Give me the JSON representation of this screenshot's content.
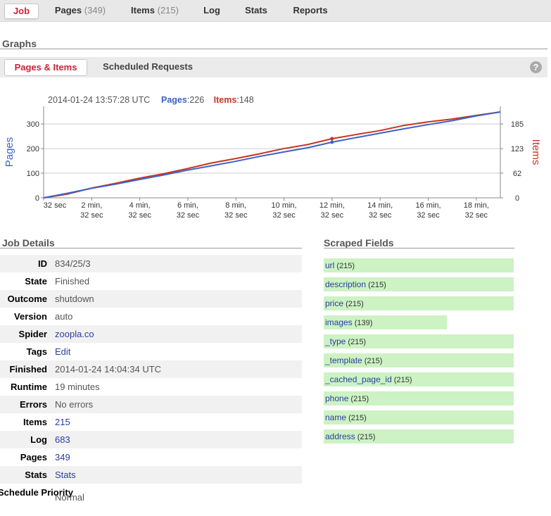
{
  "tabs": [
    {
      "label": "Job",
      "count": "",
      "active": true
    },
    {
      "label": "Pages",
      "count": "(349)"
    },
    {
      "label": "Items",
      "count": "(215)"
    },
    {
      "label": "Log",
      "count": ""
    },
    {
      "label": "Stats",
      "count": ""
    },
    {
      "label": "Reports",
      "count": ""
    }
  ],
  "graphs": {
    "title": "Graphs",
    "subtabs": [
      "Pages & Items",
      "Scheduled Requests"
    ],
    "help_icon": "?"
  },
  "chart_data": {
    "type": "line",
    "timestamp": "2014-01-24 13:57:28 UTC",
    "readout": [
      {
        "name": "Pages",
        "value": "226",
        "color": "#3c62c8"
      },
      {
        "name": "Items",
        "value": "148",
        "color": "#c8341e"
      }
    ],
    "left_axis_label": "Pages",
    "right_axis_label": "Items",
    "left_ticks": [
      0,
      100,
      200,
      300
    ],
    "right_ticks": [
      0,
      62,
      123,
      185
    ],
    "left_ylim": [
      0,
      349
    ],
    "right_ylim": [
      0,
      215
    ],
    "x_ticks": [
      "32 sec",
      "2 min, 32 sec",
      "4 min, 32 sec",
      "6 min, 32 sec",
      "8 min, 32 sec",
      "10 min, 32 sec",
      "12 min, 32 sec",
      "14 min, 32 sec",
      "16 min, 32 sec",
      "18 min, 32 sec"
    ],
    "x_minutes": [
      0.533,
      2.533,
      4.533,
      6.533,
      8.533,
      10.533,
      12.533,
      14.533,
      16.533,
      18.533
    ],
    "xlim": [
      0.533,
      19.533
    ],
    "series": [
      {
        "name": "Pages",
        "axis": "left",
        "color": "#3c62c8",
        "x": [
          0.533,
          1.5,
          2.5,
          3.5,
          4.5,
          5.5,
          6.5,
          7.5,
          8.5,
          9.5,
          10.5,
          11.5,
          12.53,
          13.5,
          14.5,
          15.5,
          16.5,
          17.5,
          18.5,
          19.533
        ],
        "y": [
          0,
          18,
          38,
          55,
          74,
          92,
          112,
          130,
          148,
          168,
          186,
          203,
          226,
          244,
          262,
          280,
          297,
          313,
          332,
          349
        ]
      },
      {
        "name": "Items",
        "axis": "right",
        "color": "#c8341e",
        "x": [
          0.533,
          1.5,
          2.5,
          3.5,
          4.5,
          5.5,
          6.5,
          7.5,
          8.5,
          9.5,
          10.5,
          11.5,
          12.53,
          13.5,
          14.5,
          15.5,
          16.5,
          17.5,
          18.5,
          19.533
        ],
        "y": [
          0,
          9,
          24,
          36,
          49,
          60,
          73,
          87,
          98,
          110,
          123,
          133,
          148,
          158,
          168,
          181,
          190,
          197,
          206,
          215
        ]
      }
    ],
    "highlight_x": 12.53
  },
  "details": {
    "title": "Job Details",
    "rows": [
      {
        "label": "ID",
        "value": "834/25/3",
        "link": false
      },
      {
        "label": "State",
        "value": "Finished",
        "link": false
      },
      {
        "label": "Outcome",
        "value": "shutdown",
        "link": false
      },
      {
        "label": "Version",
        "value": "auto",
        "link": false
      },
      {
        "label": "Spider",
        "value": "zoopla.co",
        "link": true
      },
      {
        "label": "Tags",
        "value": "Edit",
        "link": true
      },
      {
        "label": "Finished",
        "value": "2014-01-24 14:04:34 UTC",
        "link": false
      },
      {
        "label": "Runtime",
        "value": "19 minutes",
        "link": false
      },
      {
        "label": "Errors",
        "value": "No errors",
        "link": false
      },
      {
        "label": "Items",
        "value": "215",
        "link": true
      },
      {
        "label": "Log",
        "value": "683",
        "link": true
      },
      {
        "label": "Pages",
        "value": "349",
        "link": true
      },
      {
        "label": "Stats",
        "value": "Stats",
        "link": true
      },
      {
        "label": "Schedule Priority",
        "value": "Normal",
        "link": false
      }
    ]
  },
  "scraped_fields": {
    "title": "Scraped Fields",
    "total": 215,
    "items": [
      {
        "name": "url",
        "count": 215
      },
      {
        "name": "description",
        "count": 215
      },
      {
        "name": "price",
        "count": 215
      },
      {
        "name": "images",
        "count": 139
      },
      {
        "name": "_type",
        "count": 215
      },
      {
        "name": "_template",
        "count": 215
      },
      {
        "name": "_cached_page_id",
        "count": 215
      },
      {
        "name": "phone",
        "count": 215
      },
      {
        "name": "name",
        "count": 215
      },
      {
        "name": "address",
        "count": 215
      }
    ]
  },
  "colors": {
    "accent": "#d02038",
    "link": "#2a3d9e",
    "field_bar": "#cdf2c4",
    "pages": "#3c62c8",
    "items": "#c8341e"
  }
}
